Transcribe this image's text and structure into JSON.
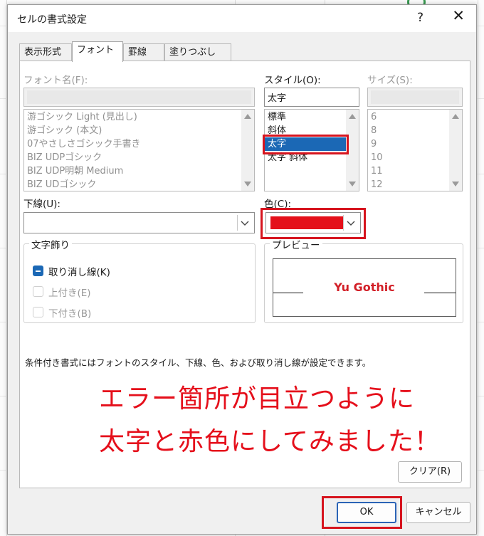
{
  "dialog": {
    "title": "セルの書式設定",
    "help": "?",
    "close": "✕"
  },
  "tabs": [
    {
      "label": "表示形式",
      "active": false
    },
    {
      "label": "フォント",
      "active": true
    },
    {
      "label": "罫線",
      "active": false
    },
    {
      "label": "塗りつぶし",
      "active": false
    }
  ],
  "font_name": {
    "label": "フォント名(F):",
    "value": "",
    "items": [
      "游ゴシック Light (見出し)",
      "游ゴシック (本文)",
      "07やさしさゴシック手書き",
      "BIZ UDPゴシック",
      "BIZ UDP明朝 Medium",
      "BIZ UDゴシック"
    ]
  },
  "style": {
    "label": "スタイル(O):",
    "value": "太字",
    "items": [
      "標準",
      "斜体",
      "太字",
      "太字 斜体"
    ],
    "selected_index": 2
  },
  "size": {
    "label": "サイズ(S):",
    "value": "",
    "items": [
      "6",
      "8",
      "9",
      "10",
      "11",
      "12"
    ]
  },
  "underline": {
    "label": "下線(U):",
    "value": ""
  },
  "color": {
    "label": "色(C):",
    "value_hex": "#e4101a"
  },
  "effects": {
    "caption": "文字飾り",
    "items": [
      {
        "label": "取り消し線(K)",
        "checked": true,
        "enabled": true
      },
      {
        "label": "上付き(E)",
        "checked": false,
        "enabled": false
      },
      {
        "label": "下付き(B)",
        "checked": false,
        "enabled": false
      }
    ]
  },
  "preview": {
    "caption": "プレビュー",
    "text": "Yu Gothic",
    "text_color": "#d21f27"
  },
  "info_text": "条件付き書式にはフォントのスタイル、下線、色、および取り消し線が設定できます。",
  "annotation": {
    "line1": "エラー箇所が目立つように",
    "line2": "太字と赤色にしてみました！",
    "color": "#e50f1b"
  },
  "buttons": {
    "clear": "クリア(R)",
    "ok": "OK",
    "cancel": "キャンセル"
  },
  "accent": "#1b68b5"
}
